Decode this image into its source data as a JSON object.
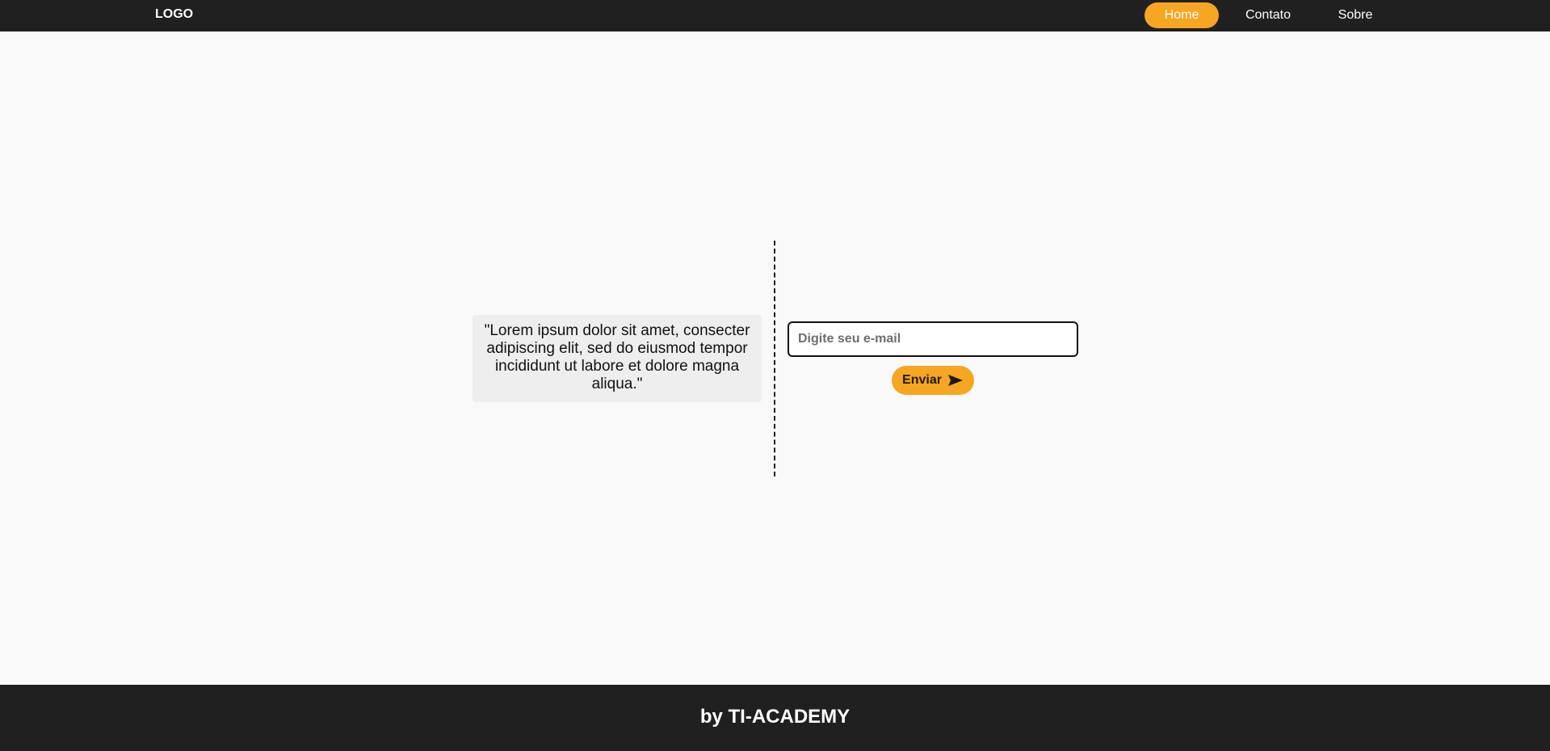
{
  "navbar": {
    "logo": "LOGO",
    "links": [
      {
        "label": "Home",
        "active": true
      },
      {
        "label": "Contato",
        "active": false
      },
      {
        "label": "Sobre",
        "active": false
      }
    ]
  },
  "main": {
    "quote": "\"Lorem ipsum dolor sit amet, consecter adipiscing elit, sed do eiusmod tempor incididunt ut labore et dolore magna aliqua.\"",
    "email_placeholder": "Digite seu e-mail",
    "email_value": "",
    "submit_label": "Enviar",
    "submit_icon": "send-icon"
  },
  "footer": {
    "text": "by TI-ACADEMY"
  },
  "colors": {
    "accent": "#f6a623",
    "bar": "#202020",
    "background": "#f9f9f9",
    "quote_background": "#eeeeee"
  }
}
